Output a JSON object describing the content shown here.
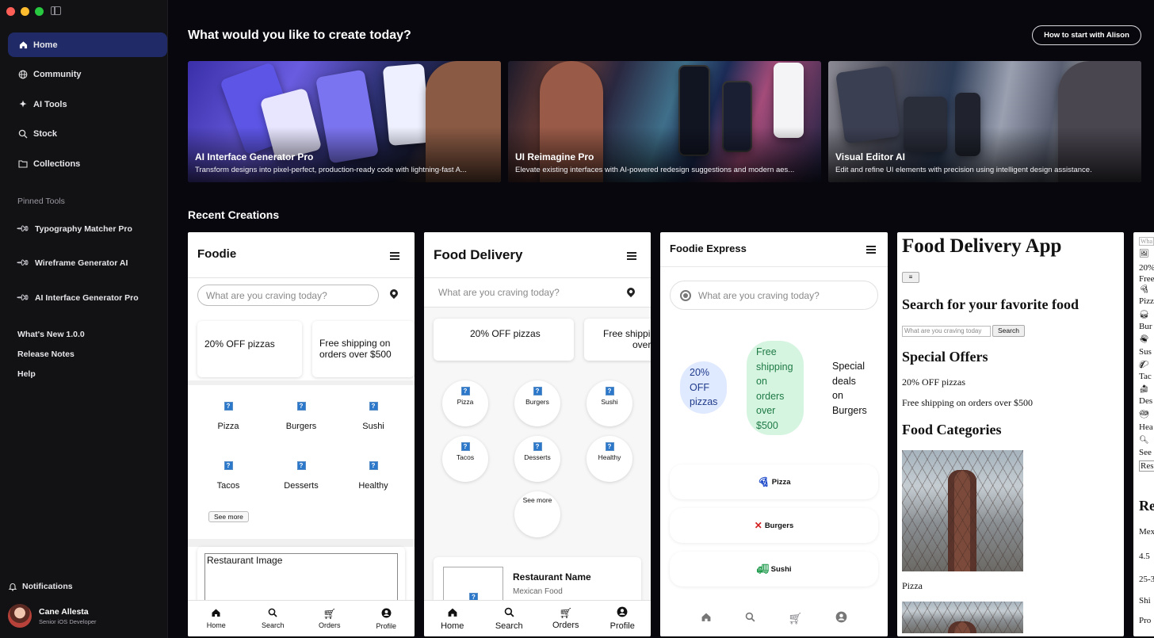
{
  "sidebar": {
    "nav": [
      {
        "label": "Home",
        "icon": "home-icon",
        "active": true
      },
      {
        "label": "Community",
        "icon": "globe-icon"
      },
      {
        "label": "AI Tools",
        "icon": "sparkle-icon"
      },
      {
        "label": "Stock",
        "icon": "search-icon"
      },
      {
        "label": "Collections",
        "icon": "folder-icon"
      }
    ],
    "pinned_title": "Pinned Tools",
    "pinned": [
      {
        "label": "Typography Matcher Pro"
      },
      {
        "label": "Wireframe Generator AI"
      },
      {
        "label": "AI Interface Generator Pro"
      }
    ],
    "links": [
      {
        "label": "What's New 1.0.0"
      },
      {
        "label": "Release Notes"
      },
      {
        "label": "Help"
      }
    ],
    "notifications": "Notifications",
    "user": {
      "name": "Cane Allesta",
      "role": "Senior iOS Developer"
    }
  },
  "main": {
    "heading": "What would you like to create today?",
    "how_button": "How to start with Alison",
    "heroes": [
      {
        "title": "AI Interface Generator Pro",
        "desc": "Transform designs into pixel-perfect, production-ready code with lightning-fast A..."
      },
      {
        "title": "UI Reimagine Pro",
        "desc": "Elevate existing interfaces with AI-powered redesign suggestions and modern aes..."
      },
      {
        "title": "Visual Editor AI",
        "desc": "Edit and refine UI elements with precision using intelligent design assistance."
      }
    ],
    "recent_title": "Recent Creations"
  },
  "card1": {
    "title": "Foodie",
    "search_placeholder": "What are you craving today?",
    "offers": [
      "20% OFF pizzas",
      "Free shipping on orders over $500"
    ],
    "categories": [
      "Pizza",
      "Burgers",
      "Sushi",
      "Tacos",
      "Desserts",
      "Healthy"
    ],
    "see_more": "See more",
    "restaurant_image": "Restaurant Image",
    "nav": [
      "Home",
      "Search",
      "Orders",
      "Profile"
    ]
  },
  "card2": {
    "title": "Food Delivery",
    "search_placeholder": "What are you craving today?",
    "offers": [
      "20% OFF pizzas",
      "Free shippi",
      "over"
    ],
    "categories": [
      "Pizza",
      "Burgers",
      "Sushi",
      "Tacos",
      "Desserts",
      "Healthy"
    ],
    "see_more": "See more",
    "restaurant_name": "Restaurant Name",
    "restaurant_type": "Mexican Food",
    "nav": [
      "Home",
      "Search",
      "Orders",
      "Profile"
    ]
  },
  "card3": {
    "title": "Foodie Express",
    "search_placeholder": "What are you craving today?",
    "offers": [
      "20% OFF pizzas",
      "Free shipping on orders over $500",
      "Special deals on Burgers"
    ],
    "offer_lines": [
      [
        "20%",
        "OFF",
        "pizzas"
      ],
      [
        "Free",
        "shipping",
        "on",
        "orders",
        "over",
        "$500"
      ],
      [
        "Special",
        "deals",
        "on",
        "Burgers"
      ]
    ],
    "categories": [
      {
        "label": "Pizza",
        "icon": "pizza-icon",
        "color": "#1a47c9"
      },
      {
        "label": "Burgers",
        "icon": "utensils-icon",
        "color": "#d32020"
      },
      {
        "label": "Sushi",
        "icon": "truck-icon",
        "color": "#1e9a4b"
      }
    ]
  },
  "card4": {
    "title": "Food Delivery App",
    "menu_btn": "≡",
    "search_heading": "Search for your favorite food",
    "search_placeholder": "What are you craving today",
    "search_btn": "Search",
    "offers_heading": "Special Offers",
    "offers": [
      "20% OFF pizzas",
      "Free shipping on orders over $500"
    ],
    "categories_heading": "Food Categories",
    "caption": "Pizza"
  },
  "card5": {
    "lines": [
      "Wha",
      "20%",
      "Free",
      "Pizz",
      "Bur",
      "Sus",
      "Tac",
      "Des",
      "Hea",
      "See",
      "Res",
      "Re",
      "Mex",
      "4.5",
      "25-3",
      "Shi",
      "Pro"
    ]
  },
  "colors": {
    "accent_nav": "#1f2a66",
    "pill_blue": "#dfe9ff",
    "pill_green": "#d6f5e1"
  }
}
